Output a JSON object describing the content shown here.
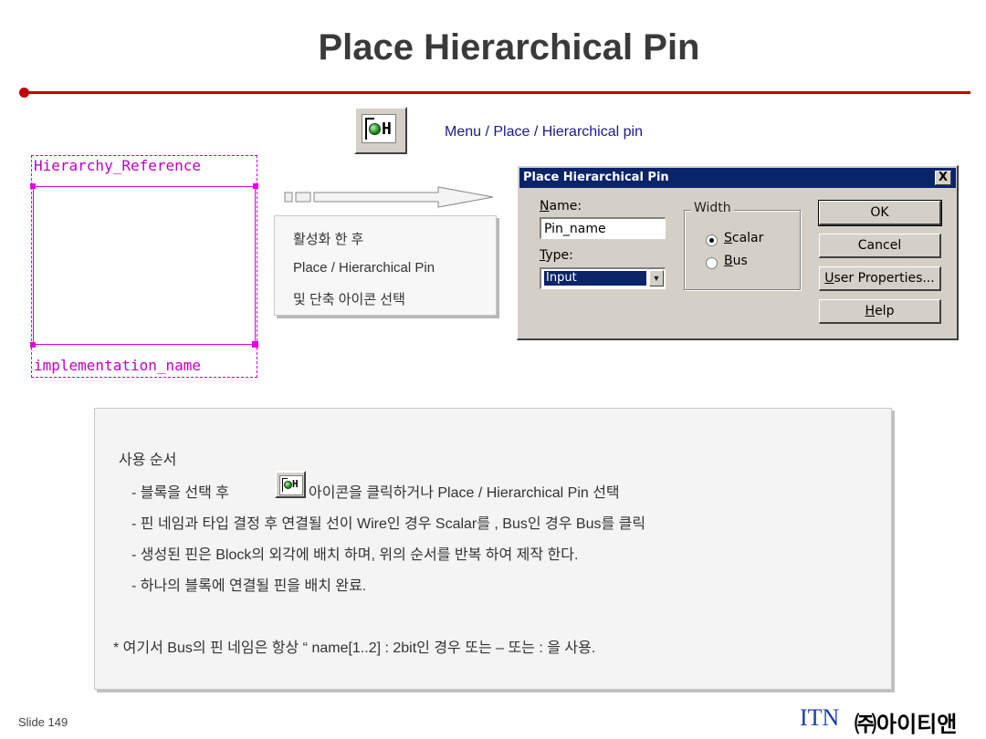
{
  "slide": {
    "title": "Place Hierarchical Pin",
    "menu_path": "Menu / Place / Hierarchical pin",
    "number": "Slide 149",
    "accent_color": "#c00000"
  },
  "toolbar_icon": {
    "label": "H",
    "icon": "hierarchical-pin-icon"
  },
  "hierarchy_block": {
    "reference": "Hierarchy_Reference",
    "implementation": "implementation_name",
    "color": "#d000d0"
  },
  "instructions": {
    "lines": [
      "활성화 한 후",
      "Place / Hierarchical Pin",
      "및 단축 아이콘 선택"
    ]
  },
  "dialog": {
    "title": "Place Hierarchical Pin",
    "close_label": "X",
    "name_label_u": "N",
    "name_label_rest": "ame:",
    "name_value": "Pin_name",
    "type_label_u": "T",
    "type_label_rest": "ype:",
    "type_value": "Input",
    "width_legend": "Width",
    "scalar_u": "S",
    "scalar_rest": "calar",
    "bus_u": "B",
    "bus_rest": "us",
    "selected_width": "Scalar",
    "buttons": {
      "ok": "OK",
      "cancel": "Cancel",
      "user_properties_u": "U",
      "user_properties_rest": "ser Properties...",
      "help_u": "H",
      "help_rest": "elp"
    }
  },
  "usage": {
    "heading": "사용 순서",
    "step1_before": "- 블록을 선택 후",
    "step1_after": "아이콘을 클릭하거나 Place / Hierarchical Pin 선택",
    "step2": "- 핀 네임과 타입 결정 후 연결될 선이 Wire인 경우 Scalar를 , Bus인 경우 Bus를 클릭",
    "step3": "- 생성된 핀은 Block의 외각에 배치 하며, 위의 순서를 반복 하여 제작 한다.",
    "step4": "- 하나의 블록에 연결될 핀을 배치 완료.",
    "note": "* 여기서 Bus의 핀 네임은 항상 “ name[1..2] : 2bit인 경우 또는 – 또는 : 을 사용."
  },
  "footer": {
    "logo": "ITN",
    "company": "㈜아이티앤"
  }
}
